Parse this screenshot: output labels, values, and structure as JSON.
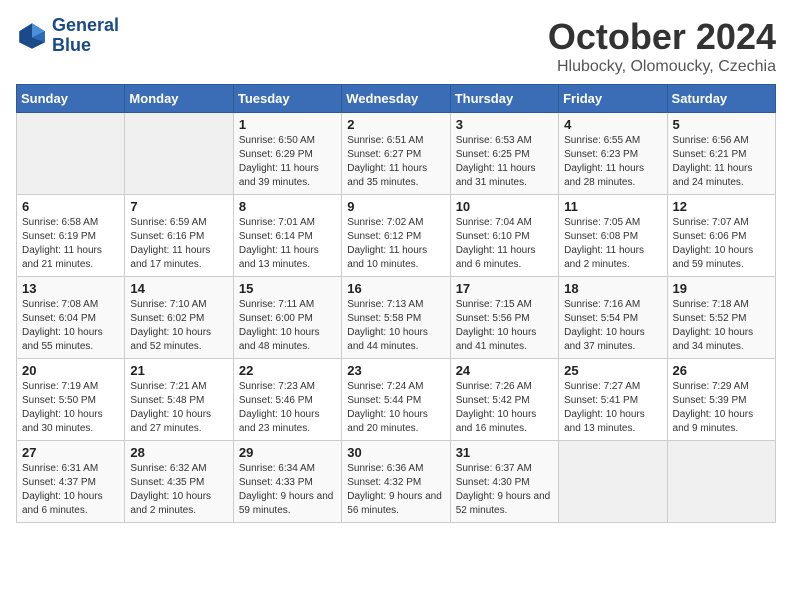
{
  "logo": {
    "line1": "General",
    "line2": "Blue"
  },
  "title": "October 2024",
  "subtitle": "Hlubocky, Olomoucky, Czechia",
  "weekdays": [
    "Sunday",
    "Monday",
    "Tuesday",
    "Wednesday",
    "Thursday",
    "Friday",
    "Saturday"
  ],
  "weeks": [
    [
      {
        "day": "",
        "detail": ""
      },
      {
        "day": "",
        "detail": ""
      },
      {
        "day": "1",
        "detail": "Sunrise: 6:50 AM\nSunset: 6:29 PM\nDaylight: 11 hours and 39 minutes."
      },
      {
        "day": "2",
        "detail": "Sunrise: 6:51 AM\nSunset: 6:27 PM\nDaylight: 11 hours and 35 minutes."
      },
      {
        "day": "3",
        "detail": "Sunrise: 6:53 AM\nSunset: 6:25 PM\nDaylight: 11 hours and 31 minutes."
      },
      {
        "day": "4",
        "detail": "Sunrise: 6:55 AM\nSunset: 6:23 PM\nDaylight: 11 hours and 28 minutes."
      },
      {
        "day": "5",
        "detail": "Sunrise: 6:56 AM\nSunset: 6:21 PM\nDaylight: 11 hours and 24 minutes."
      }
    ],
    [
      {
        "day": "6",
        "detail": "Sunrise: 6:58 AM\nSunset: 6:19 PM\nDaylight: 11 hours and 21 minutes."
      },
      {
        "day": "7",
        "detail": "Sunrise: 6:59 AM\nSunset: 6:16 PM\nDaylight: 11 hours and 17 minutes."
      },
      {
        "day": "8",
        "detail": "Sunrise: 7:01 AM\nSunset: 6:14 PM\nDaylight: 11 hours and 13 minutes."
      },
      {
        "day": "9",
        "detail": "Sunrise: 7:02 AM\nSunset: 6:12 PM\nDaylight: 11 hours and 10 minutes."
      },
      {
        "day": "10",
        "detail": "Sunrise: 7:04 AM\nSunset: 6:10 PM\nDaylight: 11 hours and 6 minutes."
      },
      {
        "day": "11",
        "detail": "Sunrise: 7:05 AM\nSunset: 6:08 PM\nDaylight: 11 hours and 2 minutes."
      },
      {
        "day": "12",
        "detail": "Sunrise: 7:07 AM\nSunset: 6:06 PM\nDaylight: 10 hours and 59 minutes."
      }
    ],
    [
      {
        "day": "13",
        "detail": "Sunrise: 7:08 AM\nSunset: 6:04 PM\nDaylight: 10 hours and 55 minutes."
      },
      {
        "day": "14",
        "detail": "Sunrise: 7:10 AM\nSunset: 6:02 PM\nDaylight: 10 hours and 52 minutes."
      },
      {
        "day": "15",
        "detail": "Sunrise: 7:11 AM\nSunset: 6:00 PM\nDaylight: 10 hours and 48 minutes."
      },
      {
        "day": "16",
        "detail": "Sunrise: 7:13 AM\nSunset: 5:58 PM\nDaylight: 10 hours and 44 minutes."
      },
      {
        "day": "17",
        "detail": "Sunrise: 7:15 AM\nSunset: 5:56 PM\nDaylight: 10 hours and 41 minutes."
      },
      {
        "day": "18",
        "detail": "Sunrise: 7:16 AM\nSunset: 5:54 PM\nDaylight: 10 hours and 37 minutes."
      },
      {
        "day": "19",
        "detail": "Sunrise: 7:18 AM\nSunset: 5:52 PM\nDaylight: 10 hours and 34 minutes."
      }
    ],
    [
      {
        "day": "20",
        "detail": "Sunrise: 7:19 AM\nSunset: 5:50 PM\nDaylight: 10 hours and 30 minutes."
      },
      {
        "day": "21",
        "detail": "Sunrise: 7:21 AM\nSunset: 5:48 PM\nDaylight: 10 hours and 27 minutes."
      },
      {
        "day": "22",
        "detail": "Sunrise: 7:23 AM\nSunset: 5:46 PM\nDaylight: 10 hours and 23 minutes."
      },
      {
        "day": "23",
        "detail": "Sunrise: 7:24 AM\nSunset: 5:44 PM\nDaylight: 10 hours and 20 minutes."
      },
      {
        "day": "24",
        "detail": "Sunrise: 7:26 AM\nSunset: 5:42 PM\nDaylight: 10 hours and 16 minutes."
      },
      {
        "day": "25",
        "detail": "Sunrise: 7:27 AM\nSunset: 5:41 PM\nDaylight: 10 hours and 13 minutes."
      },
      {
        "day": "26",
        "detail": "Sunrise: 7:29 AM\nSunset: 5:39 PM\nDaylight: 10 hours and 9 minutes."
      }
    ],
    [
      {
        "day": "27",
        "detail": "Sunrise: 6:31 AM\nSunset: 4:37 PM\nDaylight: 10 hours and 6 minutes."
      },
      {
        "day": "28",
        "detail": "Sunrise: 6:32 AM\nSunset: 4:35 PM\nDaylight: 10 hours and 2 minutes."
      },
      {
        "day": "29",
        "detail": "Sunrise: 6:34 AM\nSunset: 4:33 PM\nDaylight: 9 hours and 59 minutes."
      },
      {
        "day": "30",
        "detail": "Sunrise: 6:36 AM\nSunset: 4:32 PM\nDaylight: 9 hours and 56 minutes."
      },
      {
        "day": "31",
        "detail": "Sunrise: 6:37 AM\nSunset: 4:30 PM\nDaylight: 9 hours and 52 minutes."
      },
      {
        "day": "",
        "detail": ""
      },
      {
        "day": "",
        "detail": ""
      }
    ]
  ]
}
